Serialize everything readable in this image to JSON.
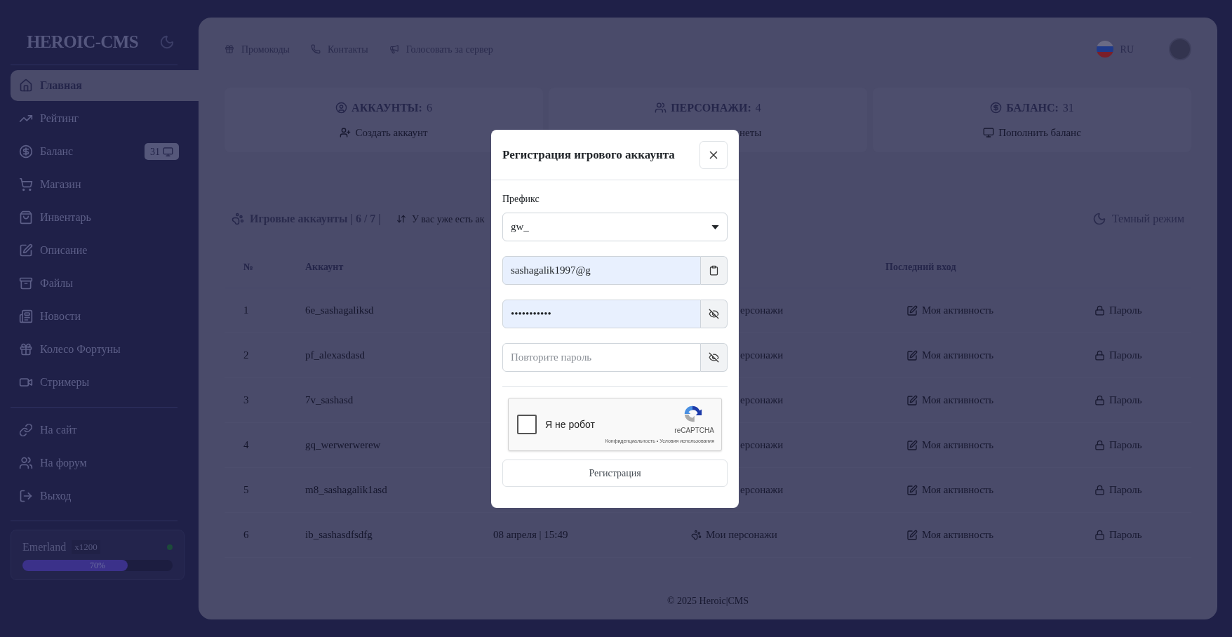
{
  "sidebar": {
    "logo": "HEROIC-CMS",
    "nav": [
      {
        "label": "Главная",
        "selected": true
      },
      {
        "label": "Рейтинг",
        "selected": false
      },
      {
        "label": "Баланс",
        "selected": false,
        "badge": "31"
      },
      {
        "label": "Магазин",
        "selected": false
      },
      {
        "label": "Инвентарь",
        "selected": false
      },
      {
        "label": "Описание",
        "selected": false
      },
      {
        "label": "Файлы",
        "selected": false
      },
      {
        "label": "Новости",
        "selected": false
      },
      {
        "label": "Колесо Фортуны",
        "selected": false
      },
      {
        "label": "Стримеры",
        "selected": false
      }
    ],
    "links": [
      "На сайт",
      "На форум",
      "Выход"
    ],
    "server": {
      "name": "Emerland",
      "rate": "x1200",
      "level": 0.7,
      "reading": "70%"
    }
  },
  "topbar": {
    "links": [
      "Промокоды",
      "Контакты",
      "Голосовать за сервер"
    ],
    "language": "RU"
  },
  "stats": [
    {
      "label": "АККАУНТЫ:",
      "value": "6",
      "action": "Создать аккаунт",
      "under_dialog": false
    },
    {
      "label": "ПЕРСОНАЖИ:",
      "value": "4",
      "action": "неты",
      "under_dialog": true
    },
    {
      "label": "БАЛАНС:",
      "value": "31",
      "action": "Пополнить баланс",
      "under_dialog": false
    }
  ],
  "accounts": {
    "title": "Игровые аккаунты | 6 / 7 |",
    "notice": "У вас уже есть ак",
    "dark_mode": "Темный режим",
    "columns": [
      "№",
      "Аккаунт",
      "Последний вход"
    ],
    "rows": [
      {
        "number": "1",
        "account": "6e_sashagaliksd",
        "characters": "ерсонажи",
        "activity": "Моя активность",
        "password": "Пароль",
        "under_dialog": true
      },
      {
        "number": "2",
        "account": "pf_alexasdasd",
        "characters": "ерсонажи",
        "activity": "Моя активность",
        "password": "Пароль",
        "under_dialog": true
      },
      {
        "number": "3",
        "account": "7v_sashasd",
        "characters": "ерсонажи",
        "activity": "Моя активность",
        "password": "Пароль",
        "under_dialog": true
      },
      {
        "number": "4",
        "account": "gq_werwerwerew",
        "characters": "ерсонажи",
        "activity": "Моя активность",
        "password": "Пароль",
        "under_dialog": true
      },
      {
        "number": "5",
        "account": "m8_sashagalik1asd",
        "characters": "ерсонажи",
        "activity": "Моя активность",
        "password": "Пароль",
        "under_dialog": true
      },
      {
        "number": "6",
        "account": "ib_sashasdfsdfg",
        "date": "08 апреля | 15:49",
        "characters": "Мои персонажи",
        "activity": "Моя активность",
        "password": "Пароль",
        "under_dialog": false
      }
    ]
  },
  "footer": "© 2025 Heroic|CMS",
  "dialog": {
    "title": "Регистрация игрового аккаунта",
    "prefix_label": "Префикс",
    "prefix_value": "gw_",
    "login_value": "sashagalik1997@g",
    "password_value": "•••••••••••",
    "repeat_placeholder": "Повторите пароль",
    "captcha": {
      "label": "Я не робот",
      "checked": false,
      "brand": "reCAPTCHA",
      "privacy": "Конфиденциальность",
      "separator": "•",
      "terms": "Условия использования"
    },
    "submit": "Регистрация"
  }
}
